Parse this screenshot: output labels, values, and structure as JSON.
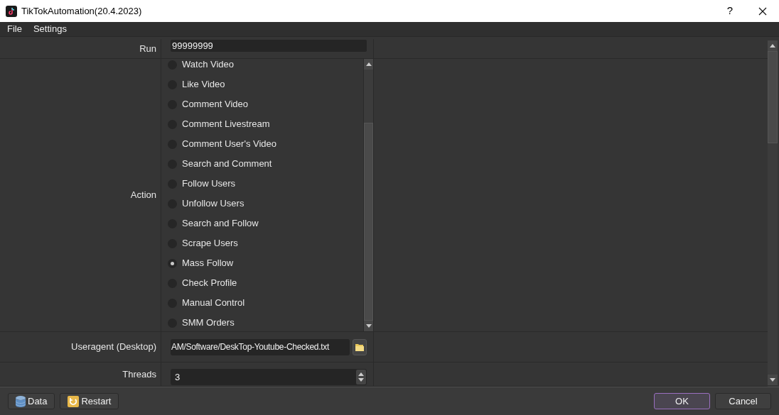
{
  "window": {
    "title": "TikTokAutomation(20.4.2023)",
    "help": "?"
  },
  "menu": [
    "File",
    "Settings"
  ],
  "form": [
    {
      "kind": "text",
      "label": "Run",
      "value": "99999999"
    },
    {
      "kind": "radio-list",
      "label": "Action",
      "options": [
        {
          "label": "Watch Video",
          "selected": false
        },
        {
          "label": "Like Video",
          "selected": false
        },
        {
          "label": "Comment Video",
          "selected": false
        },
        {
          "label": "Comment Livestream",
          "selected": false
        },
        {
          "label": "Comment User's Video",
          "selected": false
        },
        {
          "label": "Search and Comment",
          "selected": false
        },
        {
          "label": "Follow Users",
          "selected": false
        },
        {
          "label": "Unfollow Users",
          "selected": false
        },
        {
          "label": "Search and Follow",
          "selected": false
        },
        {
          "label": "Scrape Users",
          "selected": false
        },
        {
          "label": "Mass Follow",
          "selected": true
        },
        {
          "label": "Check Profile",
          "selected": false
        },
        {
          "label": "Manual Control",
          "selected": false
        },
        {
          "label": "SMM Orders",
          "selected": false
        }
      ]
    },
    {
      "kind": "file",
      "label": "Useragent (Desktop)",
      "value": "AM/Software/DeskTop-Youtube-Checked.txt"
    },
    {
      "kind": "spin",
      "label": "Threads",
      "value": "3"
    }
  ],
  "footer": {
    "left_buttons": [
      {
        "kind": "data",
        "label": "Data"
      },
      {
        "kind": "restart",
        "label": "Restart"
      }
    ],
    "right_buttons": [
      {
        "label": "OK",
        "default": true
      },
      {
        "label": "Cancel",
        "default": false
      }
    ]
  }
}
